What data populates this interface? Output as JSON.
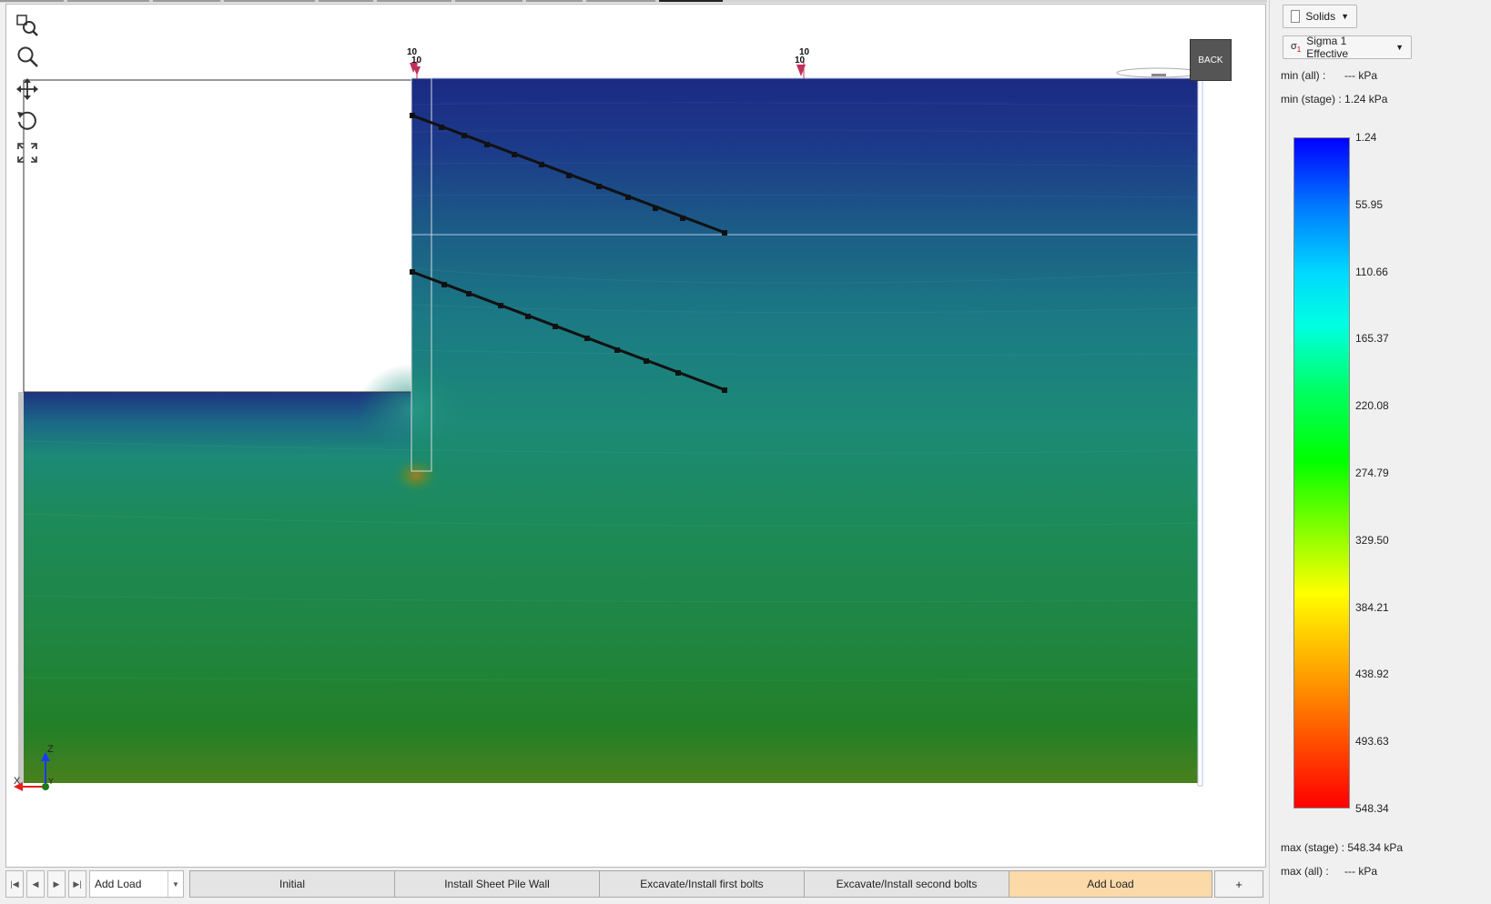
{
  "toolbar": {
    "icons": [
      "zoom-extents-icon",
      "zoom-icon",
      "pan-icon",
      "rotate-icon",
      "fit-view-icon"
    ],
    "back_label": "BACK"
  },
  "viewport": {
    "load_markers": [
      {
        "labels": [
          "10",
          "10"
        ]
      },
      {
        "labels": [
          "10",
          "10"
        ]
      }
    ],
    "axes": {
      "z_label": "Z",
      "x_label": "X",
      "y_label": "Y"
    }
  },
  "panel": {
    "display_mode": "Solids",
    "result_type": "Sigma 1 Effective",
    "min_all_label": "min (all) :",
    "min_all_value": "--- kPa",
    "min_stage_label": "min (stage) :",
    "min_stage_value": "1.24 kPa",
    "max_stage_label": "max (stage) :",
    "max_stage_value": "548.34 kPa",
    "max_all_label": "max (all) :",
    "max_all_value": "--- kPa",
    "legend": {
      "ticks": [
        "1.24",
        "55.95",
        "110.66",
        "165.37",
        "220.08",
        "274.79",
        "329.50",
        "384.21",
        "438.92",
        "493.63",
        "548.34"
      ],
      "colors": [
        "#0000ff",
        "#00d8ff",
        "#00ff00",
        "#ffff00",
        "#ff0000"
      ]
    }
  },
  "stages": {
    "current": "Add Load",
    "tabs": [
      "Initial",
      "Install Sheet Pile Wall",
      "Excavate/Install first bolts",
      "Excavate/Install second bolts",
      "Add Load"
    ],
    "add_label": "+"
  }
}
